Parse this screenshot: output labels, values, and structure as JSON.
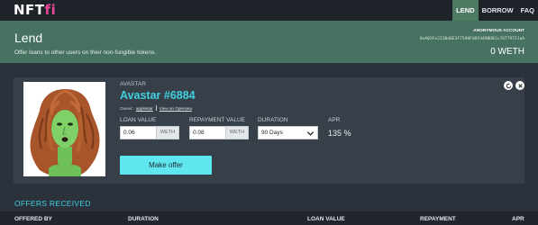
{
  "brand": {
    "prefix": "NFT",
    "suffix": "fi"
  },
  "nav": [
    {
      "label": "LEND",
      "active": true
    },
    {
      "label": "BORROW",
      "active": false
    },
    {
      "label": "FAQ",
      "active": false
    }
  ],
  "hero": {
    "title": "Lend",
    "subtitle": "Offer loans to other users on their non-fungible tokens.",
    "account_label": "ANONYMOUS ACCOUNT",
    "account_address": "0xA03Fe221Bd8E3F7590Fd8Fd49BDB1c70779721aA",
    "balance": "0 WETH"
  },
  "nft": {
    "collection": "AVASTAR",
    "name": "Avastar #6884",
    "owner_prefix": "Owner:",
    "owner_name": "applestar",
    "opensea_link": "View on Opensea"
  },
  "form": {
    "loan_value_label": "LOAN VALUE",
    "loan_value": "0.06",
    "loan_unit": "WETH",
    "repayment_label": "REPAYMENT VALUE",
    "repayment_value": "0.08",
    "repayment_unit": "WETH",
    "duration_label": "DURATION",
    "duration_value": "90 Days",
    "apr_label": "APR",
    "apr_value": "135 %",
    "submit_label": "Make offer"
  },
  "icons": {
    "refresh": "refresh-icon",
    "close": "close-icon",
    "chevron": "chevron-down-icon"
  },
  "offers": {
    "title": "OFFERS RECEIVED",
    "columns": [
      "OFFERED BY",
      "DURATION",
      "LOAN VALUE",
      "REPAYMENT",
      "APR"
    ]
  },
  "colors": {
    "accent": "#3fd0e0",
    "hero": "#477160",
    "brand_pink": "#e9489b",
    "button": "#60e6ee"
  }
}
